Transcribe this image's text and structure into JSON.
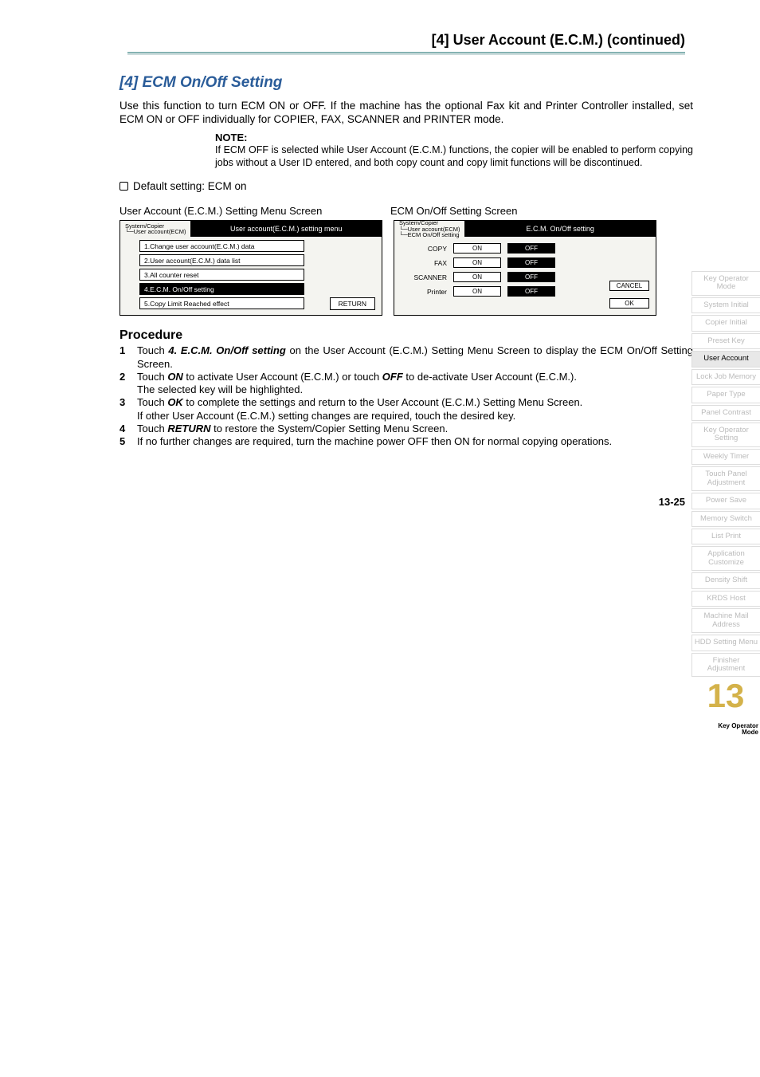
{
  "header": {
    "title": "[4] User Account (E.C.M.) (continued)"
  },
  "section": {
    "title": "[4] ECM On/Off Setting",
    "intro": "Use this function to turn ECM ON or OFF. If the machine has the optional Fax kit and Printer Controller installed, set ECM ON or OFF individually for COPIER, FAX, SCANNER and PRINTER mode.",
    "note_label": "NOTE:",
    "note_body": "If ECM OFF is selected while User Account (E.C.M.) functions, the copier will be enabled to perform copying jobs without a User ID entered, and both copy count and copy limit functions will be discontinued.",
    "default_setting": "Default setting: ECM on"
  },
  "screens": {
    "left_label": "User Account (E.C.M.) Setting Menu Screen",
    "right_label": "ECM On/Off Setting Screen",
    "left": {
      "crumb1": "System/Copier",
      "crumb2": "└─User account(ECM)",
      "title": "User account(E.C.M.) setting menu",
      "items": [
        "1.Change user account(E.C.M.) data",
        "2.User account(E.C.M.) data list",
        "3.All counter reset",
        "4.E.C.M. On/Off setting",
        "5.Copy Limit Reached effect"
      ],
      "return": "RETURN"
    },
    "right": {
      "crumb1": "System/Copier",
      "crumb2": "└─User account(ECM)",
      "crumb3": "   └─ECM On/Off setting",
      "title": "E.C.M. On/Off setting",
      "rows": [
        {
          "label": "COPY",
          "on": "ON",
          "off": "OFF"
        },
        {
          "label": "FAX",
          "on": "ON",
          "off": "OFF"
        },
        {
          "label": "SCANNER",
          "on": "ON",
          "off": "OFF"
        },
        {
          "label": "Printer",
          "on": "ON",
          "off": "OFF"
        }
      ],
      "cancel": "CANCEL",
      "ok": "OK"
    }
  },
  "procedure": {
    "title": "Procedure",
    "steps": [
      {
        "n": "1",
        "pre": "Touch ",
        "key": "4. E.C.M. On/Off setting",
        "post": " on the User Account (E.C.M.) Setting Menu Screen to display the ECM On/Off Setting Screen."
      },
      {
        "n": "2",
        "pre": "Touch ",
        "key": "ON",
        "mid": " to activate User Account (E.C.M.) or touch ",
        "key2": "OFF",
        "post": " to de-activate User Account (E.C.M.).",
        "tail": "The selected key will be highlighted."
      },
      {
        "n": "3",
        "pre": "Touch ",
        "key": "OK",
        "post": " to complete the settings and return to the User Account (E.C.M.) Setting Menu Screen.",
        "tail": "If other User Account (E.C.M.) setting changes are required, touch the desired key."
      },
      {
        "n": "4",
        "pre": "Touch ",
        "key": "RETURN",
        "post": " to restore the System/Copier Setting Menu Screen."
      },
      {
        "n": "5",
        "pre": "",
        "key": "",
        "post": "If no further changes are required, turn the machine power OFF then ON for normal copying operations."
      }
    ]
  },
  "sidebar": {
    "tabs": [
      "Key Operator Mode",
      "System Initial",
      "Copier Initial",
      "Preset Key",
      "User Account",
      "Lock Job Memory",
      "Paper Type",
      "Panel Contrast",
      "Key Operator Setting",
      "Weekly Timer",
      "Touch Panel Adjustment",
      "Power Save",
      "Memory Switch",
      "List Print",
      "Application Customize",
      "Density Shift",
      "KRDS Host",
      "Machine Mail Address",
      "HDD Setting Menu",
      "Finisher Adjustment"
    ],
    "active_index": 4,
    "chapter_num": "13",
    "chapter_label": "Key Operator\nMode"
  },
  "page_number": "13-25"
}
